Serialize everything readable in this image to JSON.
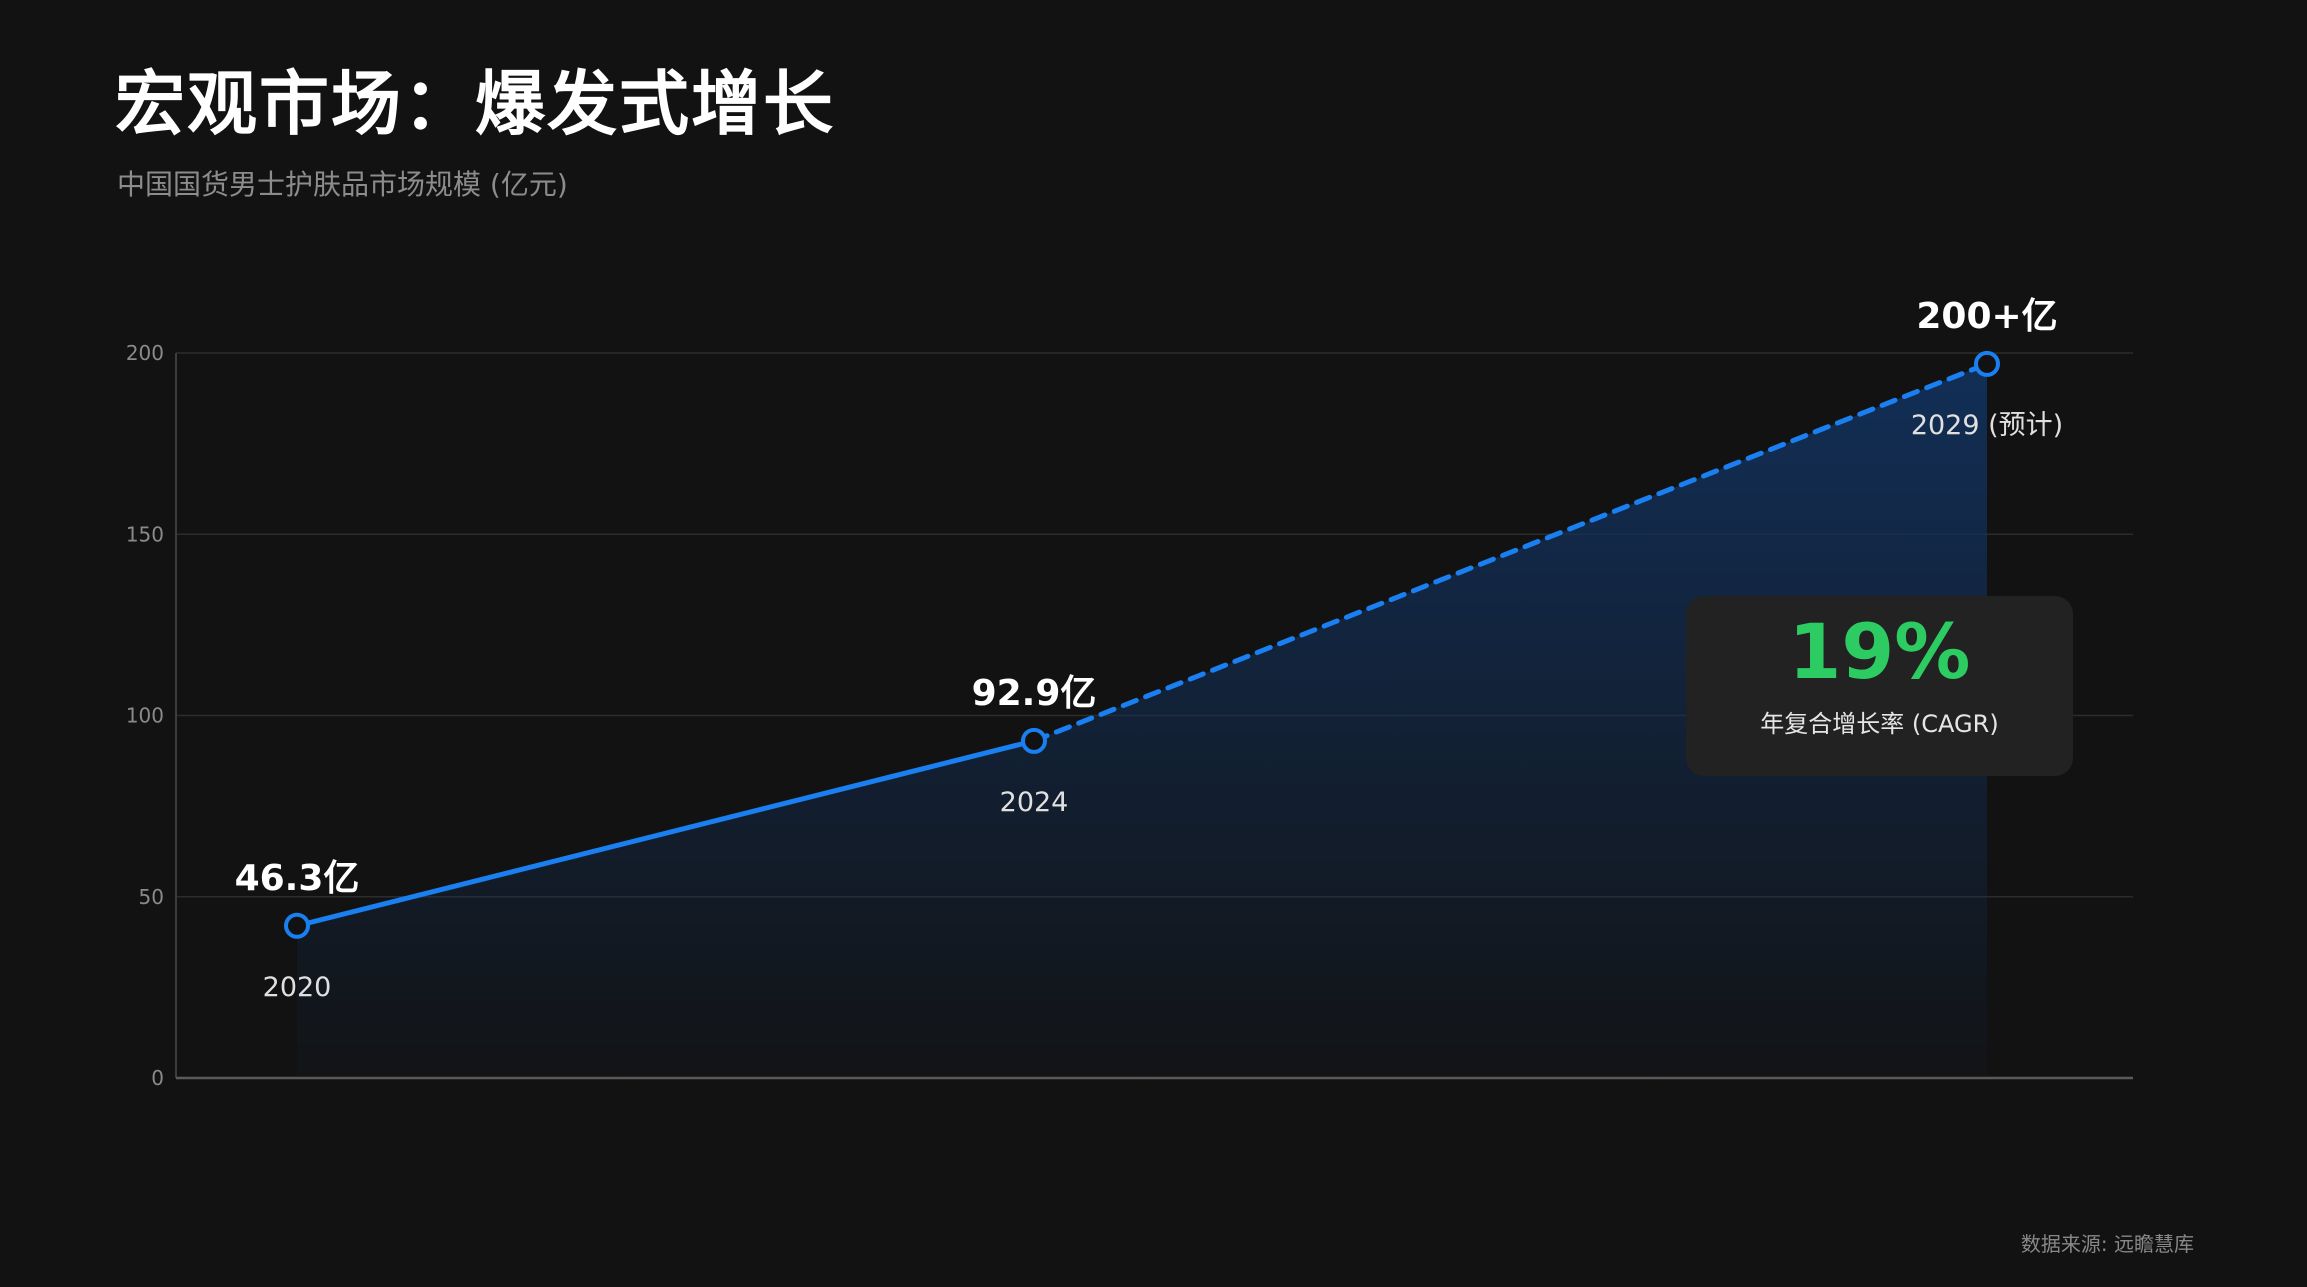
{
  "header": {
    "title": "宏观市场：爆发式增长",
    "subtitle": "中国国货男士护肤品市场规模 (亿元)"
  },
  "colors": {
    "background": "#121212",
    "line": "#1a7ff0",
    "area_top": "#12305a",
    "grid": "#2c2c2c",
    "cagr": "#2dcc62"
  },
  "chart_data": {
    "type": "line",
    "ylim": [
      0,
      200
    ],
    "y_ticks": [
      "0",
      "50",
      "100",
      "150",
      "200"
    ],
    "grid": true,
    "series": [
      {
        "points": [
          {
            "x": "2020",
            "y": 42,
            "label": "46.3亿",
            "year_label": "2020",
            "segment": "actual"
          },
          {
            "x": "2024",
            "y": 93,
            "label": "92.9亿",
            "year_label": "2024",
            "segment": "actual"
          },
          {
            "x": "2029",
            "y": 197,
            "label": "200+亿",
            "year_label": "2029 (预计)",
            "segment": "forecast"
          }
        ]
      }
    ]
  },
  "cagr": {
    "value": "19%",
    "label": "年复合增长率 (CAGR)"
  },
  "source": "数据来源: 远瞻慧库"
}
